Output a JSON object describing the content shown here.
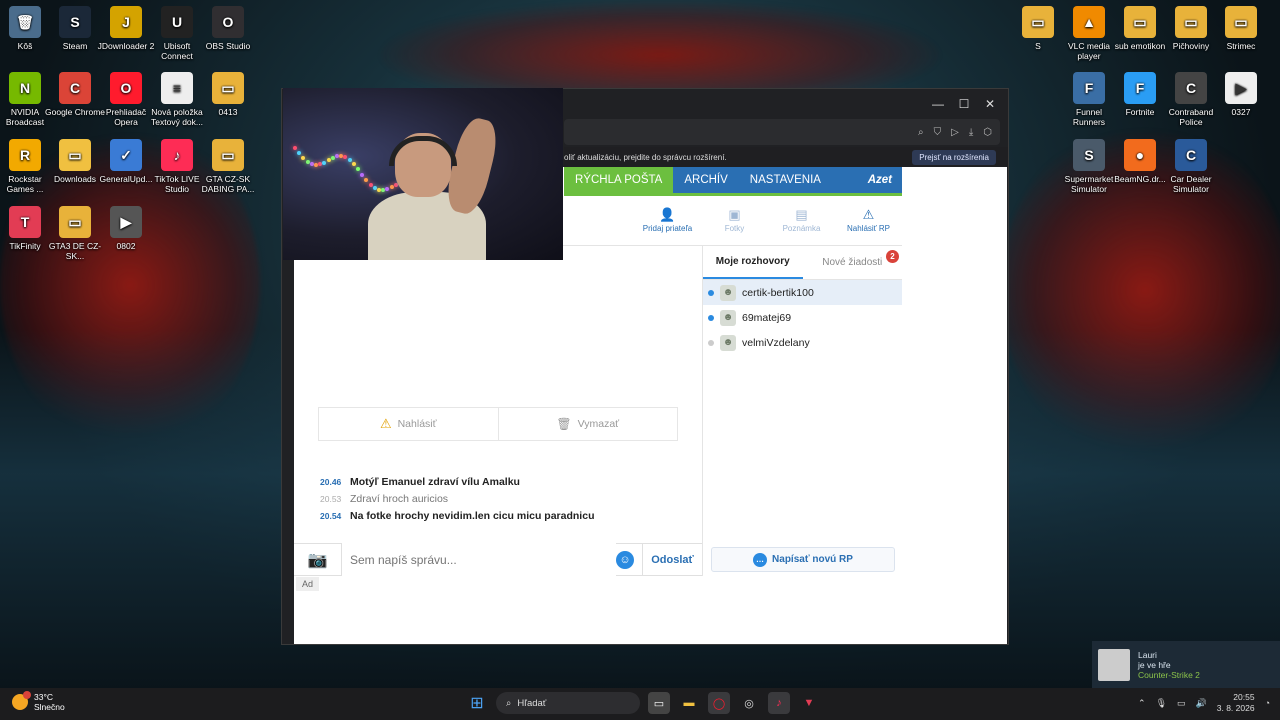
{
  "desktop": {
    "left_icons": [
      {
        "label": "Kôš",
        "icon": "recycle-bin-icon",
        "color": "#4a6c8c",
        "glyph": "🗑"
      },
      {
        "label": "Steam",
        "icon": "steam-icon",
        "color": "#1b2838",
        "glyph": "S"
      },
      {
        "label": "JDownloader 2",
        "icon": "jdownloader-icon",
        "color": "#d4a300",
        "glyph": "J"
      },
      {
        "label": "Ubisoft Connect",
        "icon": "ubisoft-icon",
        "color": "#222",
        "glyph": "U"
      },
      {
        "label": "OBS Studio",
        "icon": "obs-icon",
        "color": "#302e31",
        "glyph": "O"
      },
      {
        "label": "NVIDIA Broadcast",
        "icon": "nvidia-icon",
        "color": "#76b900",
        "glyph": "N"
      },
      {
        "label": "Google Chrome",
        "icon": "chrome-icon",
        "color": "#db4437",
        "glyph": "C"
      },
      {
        "label": "Prehliadač Opera",
        "icon": "opera-icon",
        "color": "#ff1b2d",
        "glyph": "O"
      },
      {
        "label": "Nová položka Textový dok...",
        "icon": "text-document-icon",
        "color": "#eeeeee",
        "glyph": "≡"
      },
      {
        "label": "0413",
        "icon": "folder-icon",
        "color": "#e8b23a",
        "glyph": "▭"
      },
      {
        "label": "Rockstar Games ...",
        "icon": "rockstar-icon",
        "color": "#f2a900",
        "glyph": "R"
      },
      {
        "label": "Downloads",
        "icon": "folder-icon",
        "color": "#f0c040",
        "glyph": "▭"
      },
      {
        "label": "GeneralUpd...",
        "icon": "shield-icon",
        "color": "#3a7bd5",
        "glyph": "✓"
      },
      {
        "label": "TikTok LIVE Studio",
        "icon": "tiktok-icon",
        "color": "#fe2c55",
        "glyph": "♪"
      },
      {
        "label": "GTA CZ-SK DABING PA...",
        "icon": "folder-icon",
        "color": "#e8b23a",
        "glyph": "▭"
      },
      {
        "label": "TikFinity",
        "icon": "tikfinity-icon",
        "color": "#e23c54",
        "glyph": "T"
      },
      {
        "label": "GTA3 DE CZ-SK...",
        "icon": "folder-icon",
        "color": "#e8b23a",
        "glyph": "▭"
      },
      {
        "label": "0802",
        "icon": "video-file-icon",
        "color": "#555555",
        "glyph": "▶"
      }
    ],
    "right_icons": [
      {
        "label": "S",
        "icon": "folder-icon",
        "color": "#e8b23a",
        "glyph": "▭"
      },
      {
        "label": "VLC media player",
        "icon": "vlc-icon",
        "color": "#f08a00",
        "glyph": "▲"
      },
      {
        "label": "sub emotikon",
        "icon": "folder-icon",
        "color": "#e8b23a",
        "glyph": "▭"
      },
      {
        "label": "Pičhoviny",
        "icon": "folder-icon",
        "color": "#e8b23a",
        "glyph": "▭"
      },
      {
        "label": "Strimec",
        "icon": "folder-icon",
        "color": "#e8b23a",
        "glyph": "▭"
      },
      {
        "label": "Funnel Runners",
        "icon": "game-icon",
        "color": "#3a6ea5",
        "glyph": "F"
      },
      {
        "label": "Fortnite",
        "icon": "fortnite-icon",
        "color": "#2a9df4",
        "glyph": "F"
      },
      {
        "label": "Contraband Police",
        "icon": "game-icon",
        "color": "#444",
        "glyph": "C"
      },
      {
        "label": "0327",
        "icon": "video-file-icon",
        "color": "#eeeeee",
        "glyph": "▶"
      },
      {
        "label": "Supermarket Simulator",
        "icon": "game-icon",
        "color": "#4a5a6a",
        "glyph": "S"
      },
      {
        "label": "BeamNG.dr...",
        "icon": "beamng-icon",
        "color": "#f26b1d",
        "glyph": "●"
      },
      {
        "label": "Car Dealer Simulator",
        "icon": "game-icon",
        "color": "#2a5a9a",
        "glyph": "C"
      }
    ]
  },
  "notice": {
    "text": "oliť aktualizáciu, prejdite do správcu rozšírení.",
    "button": "Prejsť na rozšírenia"
  },
  "nav": {
    "tabs": [
      "RÝCHLA POŠTA",
      "ARCHÍV",
      "NASTAVENIA"
    ],
    "logo": "Azet"
  },
  "tools": [
    {
      "label": "Pridaj priateľa",
      "icon": "add-user-icon",
      "glyph": "👤+",
      "disabled": false
    },
    {
      "label": "Fotky",
      "icon": "photos-icon",
      "glyph": "▣",
      "disabled": true
    },
    {
      "label": "Poznámka",
      "icon": "note-icon",
      "glyph": "▤",
      "disabled": true
    },
    {
      "label": "Nahlásiť RP",
      "icon": "warning-icon",
      "glyph": "⚠",
      "disabled": false
    }
  ],
  "chat": {
    "report_label": "Nahlásiť",
    "delete_label": "Vymazať",
    "messages": [
      {
        "time": "20.46",
        "text": "Motýľ Emanuel zdraví vílu Amalku",
        "read": false
      },
      {
        "time": "20.53",
        "text": "Zdraví hroch auricios",
        "read": true
      },
      {
        "time": "20.54",
        "text": "Na fotke hrochy nevidim.len cicu micu paradnicu",
        "read": false
      }
    ],
    "input_placeholder": "Sem napíš správu...",
    "send_label": "Odoslať",
    "ad_label": "Ad"
  },
  "panel": {
    "tabs": [
      "Moje rozhovory",
      "Nové žiadosti"
    ],
    "requests_badge": "2",
    "conversations": [
      {
        "name": "certik-bertik100",
        "online": true,
        "selected": true
      },
      {
        "name": "69matej69",
        "online": true,
        "selected": false
      },
      {
        "name": "velmiVzdelany",
        "online": false,
        "selected": false
      }
    ],
    "new_rp_label": "Napísať novú RP"
  },
  "toast": {
    "name": "Lauri",
    "status": "je ve hře",
    "game": "Counter-Strike 2"
  },
  "taskbar": {
    "temperature": "33°C",
    "weather": "Slnečno",
    "search_placeholder": "Hľadať",
    "time": "20:55",
    "date": "3. 8. 2026"
  }
}
